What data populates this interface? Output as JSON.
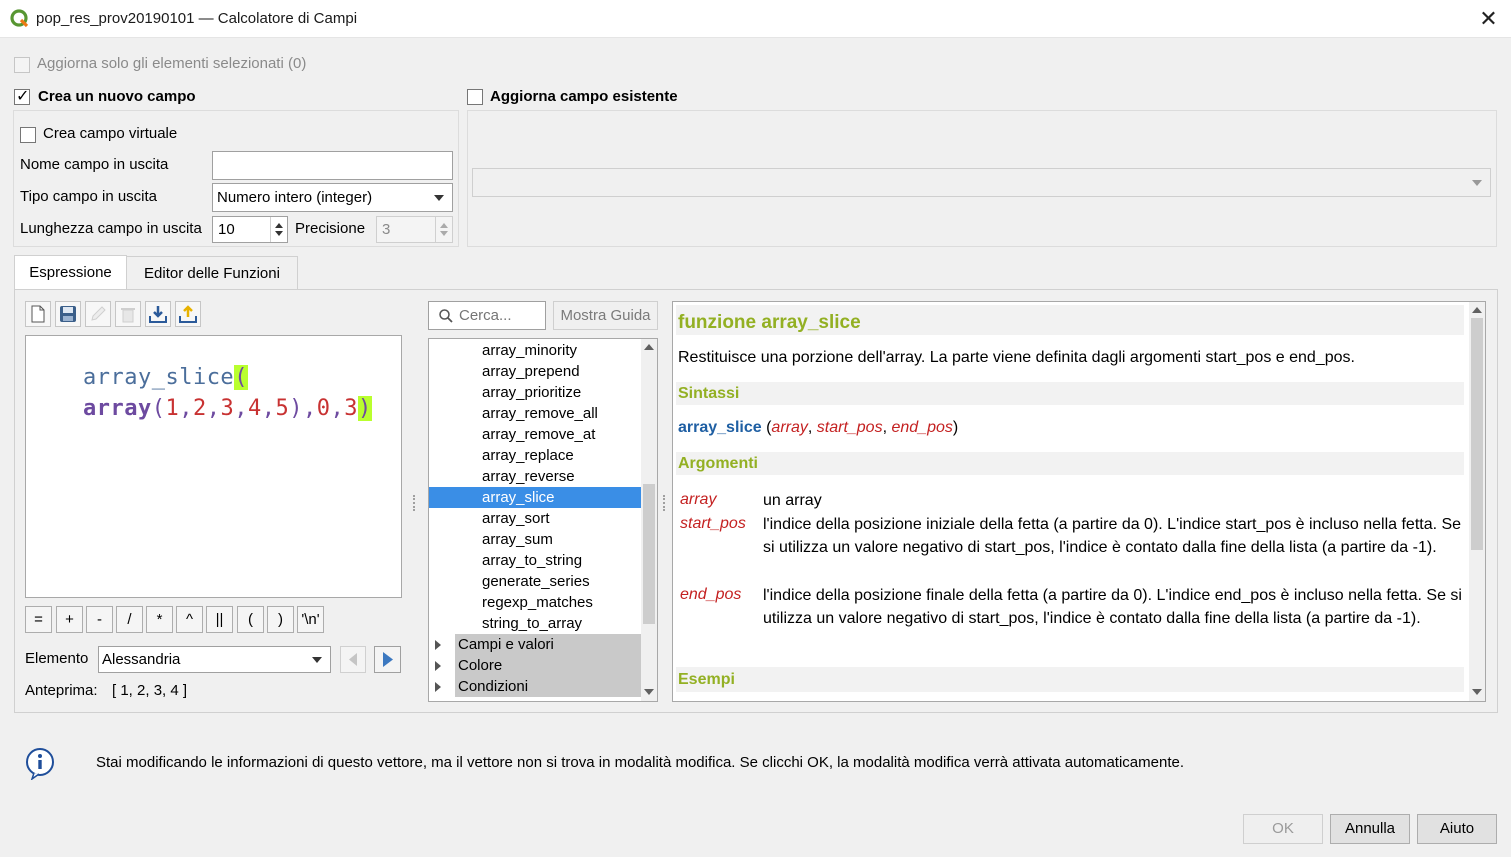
{
  "window": {
    "title": "pop_res_prov20190101 — Calcolatore di Campi",
    "close": "✕"
  },
  "update_selected_only": "Aggiorna solo gli elementi selezionati (0)",
  "create_new_field": {
    "label": "Crea un nuovo campo",
    "checked": true,
    "virtual_field": "Crea campo virtuale",
    "output_name_label": "Nome campo in uscita",
    "output_name_value": "",
    "output_type_label": "Tipo campo in uscita",
    "output_type_value": "Numero intero (integer)",
    "output_length_label": "Lunghezza campo in uscita",
    "output_length_value": "10",
    "precision_label": "Precisione",
    "precision_value": "3"
  },
  "update_existing_field": {
    "label": "Aggiorna campo esistente",
    "checked": false,
    "field_value": ""
  },
  "tabs": [
    {
      "label": "Espressione",
      "active": true
    },
    {
      "label": "Editor delle Funzioni",
      "active": false
    }
  ],
  "toolbar_icons": [
    "new-file-icon",
    "save-icon",
    "edit-icon",
    "delete-icon",
    "import-icon",
    "export-icon"
  ],
  "expression": {
    "line1_fn": "array_slice",
    "line1_paren": "(",
    "line2_fn": "array",
    "line2_open": "(",
    "line2_args": [
      "1",
      "2",
      "3",
      "4",
      "5"
    ],
    "line2_close": ")",
    "line2_arg_b": "0",
    "line2_arg_c": "3",
    "line2_end": ")",
    "comma": ","
  },
  "operators": [
    "=",
    "+",
    "-",
    "/",
    "*",
    "^",
    "||",
    "(",
    ")",
    "'\\n'"
  ],
  "element": {
    "label": "Elemento",
    "value": "Alessandria"
  },
  "preview": {
    "label": "Anteprima:",
    "value": "[ 1, 2, 3, 4 ]"
  },
  "search": {
    "placeholder": "Cerca...",
    "show_help": "Mostra Guida"
  },
  "function_list": {
    "items": [
      "array_minority",
      "array_prepend",
      "array_prioritize",
      "array_remove_all",
      "array_remove_at",
      "array_replace",
      "array_reverse",
      "array_slice",
      "array_sort",
      "array_sum",
      "array_to_string",
      "generate_series",
      "regexp_matches",
      "string_to_array"
    ],
    "selected": "array_slice",
    "groups": [
      "Campi e valori",
      "Colore",
      "Condizioni"
    ]
  },
  "help": {
    "title": "funzione array_slice",
    "description": "Restituisce una porzione dell'array. La parte viene definita dagli argomenti start_pos e end_pos.",
    "syntax_heading": "Sintassi",
    "syntax_fn": "array_slice",
    "syntax_args": [
      "array",
      "start_pos",
      "end_pos"
    ],
    "syntax_open": "(",
    "syntax_close": ")",
    "syntax_sep": ", ",
    "arguments_heading": "Argomenti",
    "arguments": [
      {
        "name": "array",
        "desc": "un array"
      },
      {
        "name": "start_pos",
        "desc": "l'indice della posizione iniziale della fetta (a partire da 0). L'indice start_pos è incluso nella fetta. Se si utilizza un valore negativo di start_pos, l'indice è contato dalla fine della lista (a partire da -1)."
      },
      {
        "name": "end_pos",
        "desc": "l'indice della posizione finale della fetta (a partire da 0). L'indice end_pos è incluso nella fetta. Se si utilizza un valore negativo di start_pos, l'indice è contato dalla fine della lista (a partire da -1)."
      }
    ],
    "examples_heading": "Esempi"
  },
  "info_message": "Stai modificando le informazioni di questo vettore, ma il vettore non si trova in modalità modifica. Se clicchi OK, la modalità modifica verrà attivata automaticamente.",
  "buttons": {
    "ok": "OK",
    "cancel": "Annulla",
    "help": "Aiuto"
  },
  "colors": {
    "selection": "#3a8ee6",
    "help_heading": "#93b023",
    "argument_name": "#c42121",
    "bracket_highlight": "#b9ff2e"
  }
}
